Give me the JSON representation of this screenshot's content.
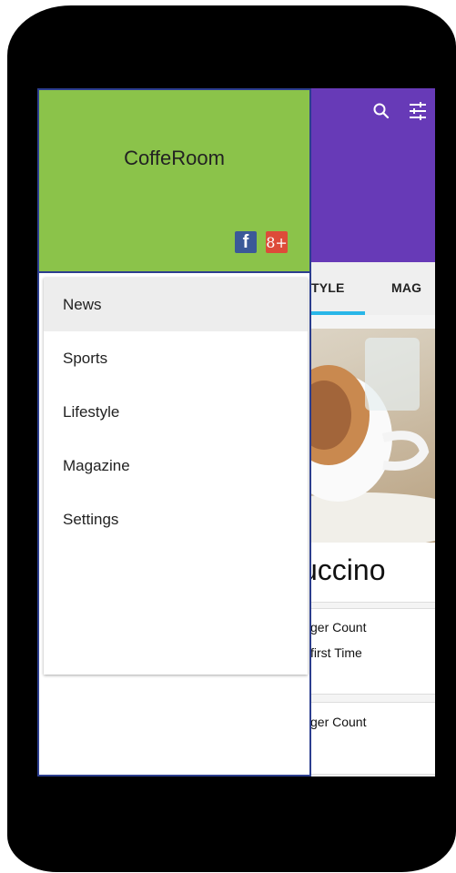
{
  "app": {
    "tabs": [
      {
        "label": "TYLE"
      },
      {
        "label": "MAG"
      }
    ],
    "featured": {
      "title": "uccino"
    },
    "articles": [
      {
        "line1": "ger Count",
        "line2": "first Time"
      },
      {
        "line1": "ger Count",
        "line2": ""
      }
    ],
    "icons": {
      "search": "search-icon",
      "filter": "tune-icon"
    }
  },
  "drawer": {
    "brand": "CoffeRoom",
    "social": [
      {
        "glyph": "f",
        "icon": "facebook-icon"
      },
      {
        "glyph": "8+",
        "icon": "google-plus-icon"
      }
    ],
    "menu": [
      {
        "label": "News",
        "active": true
      },
      {
        "label": "Sports"
      },
      {
        "label": "Lifestyle"
      },
      {
        "label": "Magazine"
      },
      {
        "label": "Settings"
      }
    ]
  },
  "colors": {
    "appbar": "#673ab7",
    "drawer_header": "#8bc34a",
    "tab_indicator": "#29b6e8",
    "facebook": "#3b5998",
    "google_plus": "#dd4b39"
  }
}
